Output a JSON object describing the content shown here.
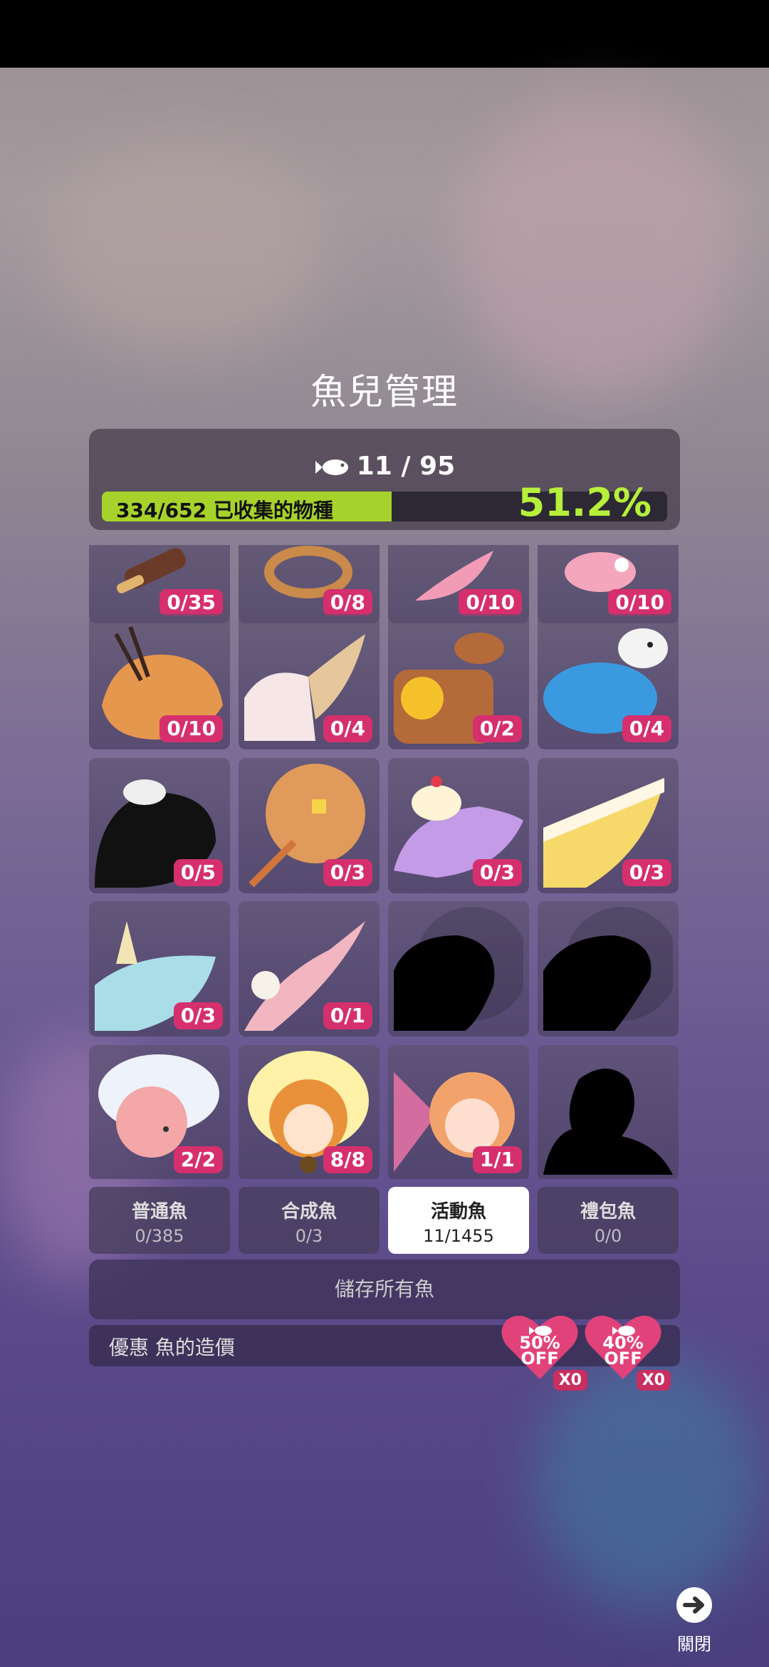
{
  "header": {
    "title": "魚兒管理"
  },
  "summary": {
    "fish_count": "11 / 95",
    "progress_text": "334/652 已收集的物種",
    "progress_fraction": 0.512,
    "percent_text": "51.2%"
  },
  "grid": {
    "rows": [
      [
        "0/35",
        "0/8",
        "0/10",
        "0/10"
      ],
      [
        "0/10",
        "0/4",
        "0/2",
        "0/4"
      ],
      [
        "0/5",
        "0/3",
        "0/3",
        "0/3"
      ],
      [
        "0/3",
        "0/1",
        "",
        ""
      ],
      [
        "2/2",
        "8/8",
        "1/1",
        ""
      ]
    ]
  },
  "tabs": [
    {
      "label": "普通魚",
      "count": "0/385"
    },
    {
      "label": "合成魚",
      "count": "0/3"
    },
    {
      "label": "活動魚",
      "count": "11/1455"
    },
    {
      "label": "禮包魚",
      "count": "0/0"
    }
  ],
  "save_all_label": "儲存所有魚",
  "discount": {
    "label": "優惠 魚的造價",
    "items": [
      {
        "text": "50%\nOFF",
        "qty": "X0"
      },
      {
        "text": "40%\nOFF",
        "qty": "X0"
      }
    ]
  },
  "close_label": "關閉",
  "colors": {
    "accent_pink": "#d62f6e",
    "progress_green": "#a7d22b",
    "percent_green": "#b7f03b"
  }
}
